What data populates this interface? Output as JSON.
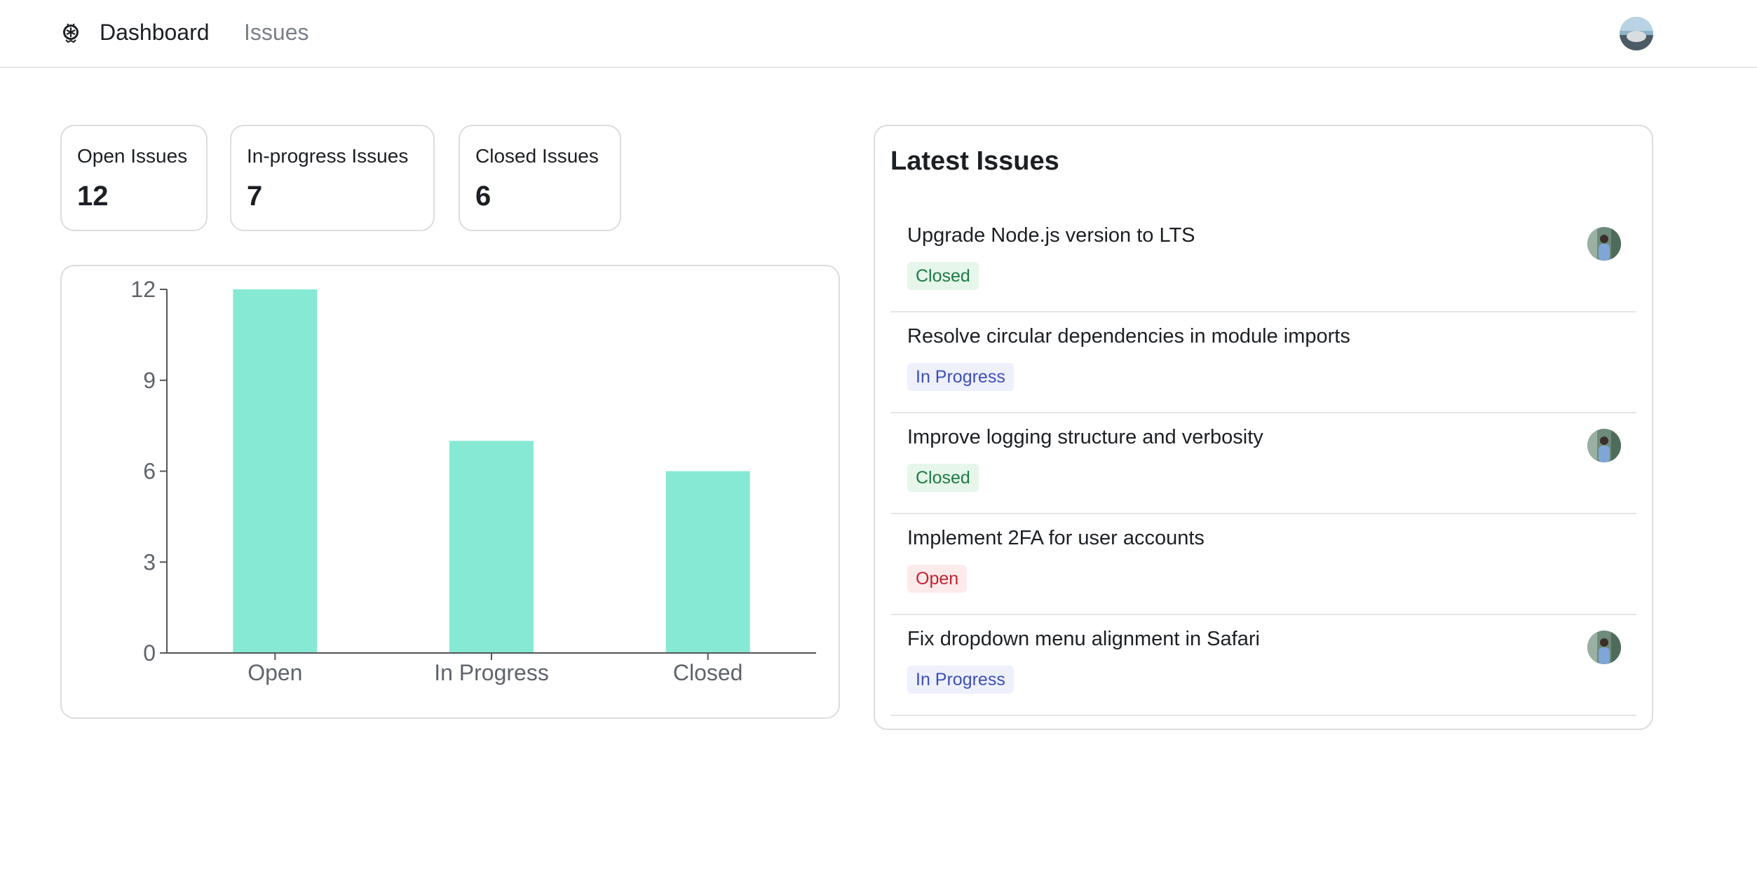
{
  "navbar": {
    "logo_icon": "bug-logo-icon",
    "links": [
      {
        "label": "Dashboard",
        "active": true
      },
      {
        "label": "Issues",
        "active": false
      }
    ],
    "avatar_icon": "user-avatar"
  },
  "stats": [
    {
      "label": "Open Issues",
      "value": "12"
    },
    {
      "label": "In-progress Issues",
      "value": "7"
    },
    {
      "label": "Closed Issues",
      "value": "6"
    }
  ],
  "chart_data": {
    "type": "bar",
    "categories": [
      "Open",
      "In Progress",
      "Closed"
    ],
    "values": [
      12,
      7,
      6
    ],
    "yticks": [
      0,
      3,
      6,
      9,
      12
    ],
    "ylim": [
      0,
      12
    ],
    "bar_color": "#86e9d4",
    "grid": false
  },
  "latest_issues": {
    "title": "Latest Issues",
    "items": [
      {
        "title": "Upgrade Node.js version to LTS",
        "status": "Closed",
        "status_key": "closed",
        "has_assignee": true
      },
      {
        "title": "Resolve circular dependencies in module imports",
        "status": "In Progress",
        "status_key": "inprogress",
        "has_assignee": false
      },
      {
        "title": "Improve logging structure and verbosity",
        "status": "Closed",
        "status_key": "closed",
        "has_assignee": true
      },
      {
        "title": "Implement 2FA for user accounts",
        "status": "Open",
        "status_key": "open",
        "has_assignee": false
      },
      {
        "title": "Fix dropdown menu alignment in Safari",
        "status": "In Progress",
        "status_key": "inprogress",
        "has_assignee": true
      }
    ]
  },
  "colors": {
    "closed_badge_bg": "#e6f6eb",
    "closed_badge_text": "#1e7a45",
    "inprogress_badge_bg": "#eef0fc",
    "inprogress_badge_text": "#3f4fb5",
    "open_badge_bg": "#fdebec",
    "open_badge_text": "#c4232f"
  }
}
